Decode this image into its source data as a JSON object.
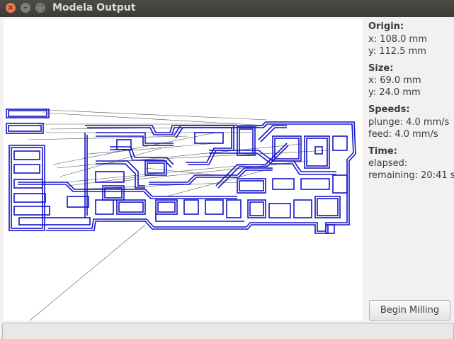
{
  "window": {
    "title": "Modela Output"
  },
  "origin": {
    "heading": "Origin:",
    "x": "x: 108.0 mm",
    "y": "y: 112.5 mm"
  },
  "size": {
    "heading": "Size:",
    "x": "x: 69.0 mm",
    "y": "y: 24.0 mm"
  },
  "speeds": {
    "heading": "Speeds:",
    "plunge": "plunge: 4.0 mm/s",
    "feed": "feed: 4.0 mm/s"
  },
  "time": {
    "heading": "Time:",
    "elapsed": "elapsed:",
    "remaining": "remaining: 20:41 s"
  },
  "actions": {
    "begin_label": "Begin Milling"
  },
  "colors": {
    "toolpath": "#1414c8",
    "travel": "#555555",
    "titlebar": "#3c3b37",
    "close": "#f07746"
  }
}
